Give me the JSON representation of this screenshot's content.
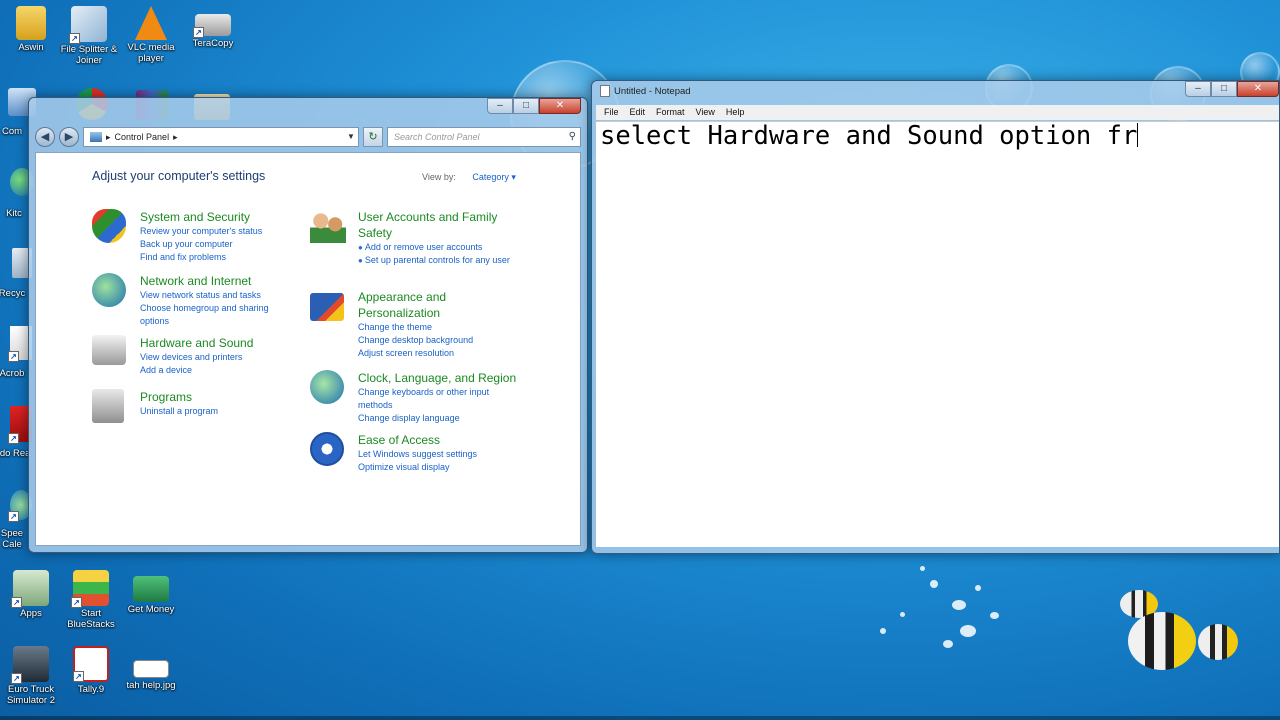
{
  "desktop": {
    "icons": [
      {
        "caption": "Aswin",
        "icon": "user-folder-icon"
      },
      {
        "caption": "File Splitter & Joiner",
        "icon": "file-splitter-icon"
      },
      {
        "caption": "VLC media player",
        "icon": "vlc-icon"
      },
      {
        "caption": "TeraCopy",
        "icon": "teracopy-icon"
      },
      {
        "caption": "Apps",
        "icon": "apps-icon"
      },
      {
        "caption": "Start BlueStacks",
        "icon": "bluestacks-icon"
      },
      {
        "caption": "Get Money",
        "icon": "get-money-icon"
      },
      {
        "caption": "Euro Truck Simulator 2",
        "icon": "euro-truck-icon"
      },
      {
        "caption": "Tally.9",
        "icon": "tally-icon"
      },
      {
        "caption": "tah help.jpg",
        "icon": "image-file-icon"
      }
    ],
    "partial_left_labels": [
      "Com",
      "Kitc",
      "Recyc",
      "Acrob",
      "Ado Rea",
      "Spee Cale"
    ]
  },
  "control_panel": {
    "window_controls": {
      "minimize": "–",
      "maximize": "□",
      "close": "✕"
    },
    "address": {
      "root": "▸",
      "path": "Control Panel",
      "sep": "▸"
    },
    "search_placeholder": "Search Control Panel",
    "heading": "Adjust your computer's settings",
    "view_by_label": "View by:",
    "view_by_value": "Category ▾",
    "categories_left": [
      {
        "title": "System and Security",
        "links": [
          "Review your computer's status",
          "Back up your computer",
          "Find and fix problems"
        ],
        "icon": "system-security-icon"
      },
      {
        "title": "Network and Internet",
        "links": [
          "View network status and tasks",
          "Choose homegroup and sharing",
          "options"
        ],
        "icon": "network-internet-icon"
      },
      {
        "title": "Hardware and Sound",
        "links": [
          "View devices and printers",
          "Add a device"
        ],
        "icon": "hardware-sound-icon"
      },
      {
        "title": "Programs",
        "links": [
          "Uninstall a program"
        ],
        "icon": "programs-icon"
      }
    ],
    "categories_right": [
      {
        "title": "User Accounts and Family Safety",
        "links": [
          "Add or remove user accounts",
          "Set up parental controls for any user"
        ],
        "icon": "user-accounts-icon"
      },
      {
        "title": "Appearance and Personalization",
        "links": [
          "Change the theme",
          "Change desktop background",
          "Adjust screen resolution"
        ],
        "icon": "appearance-icon"
      },
      {
        "title": "Clock, Language, and Region",
        "links": [
          "Change keyboards or other input methods",
          "Change display language"
        ],
        "icon": "clock-language-icon"
      },
      {
        "title": "Ease of Access",
        "links": [
          "Let Windows suggest settings",
          "Optimize visual display"
        ],
        "icon": "ease-of-access-icon"
      }
    ]
  },
  "notepad": {
    "title": "Untitled - Notepad",
    "menu": [
      "File",
      "Edit",
      "Format",
      "View",
      "Help"
    ],
    "content": "select Hardware and Sound option fr"
  }
}
